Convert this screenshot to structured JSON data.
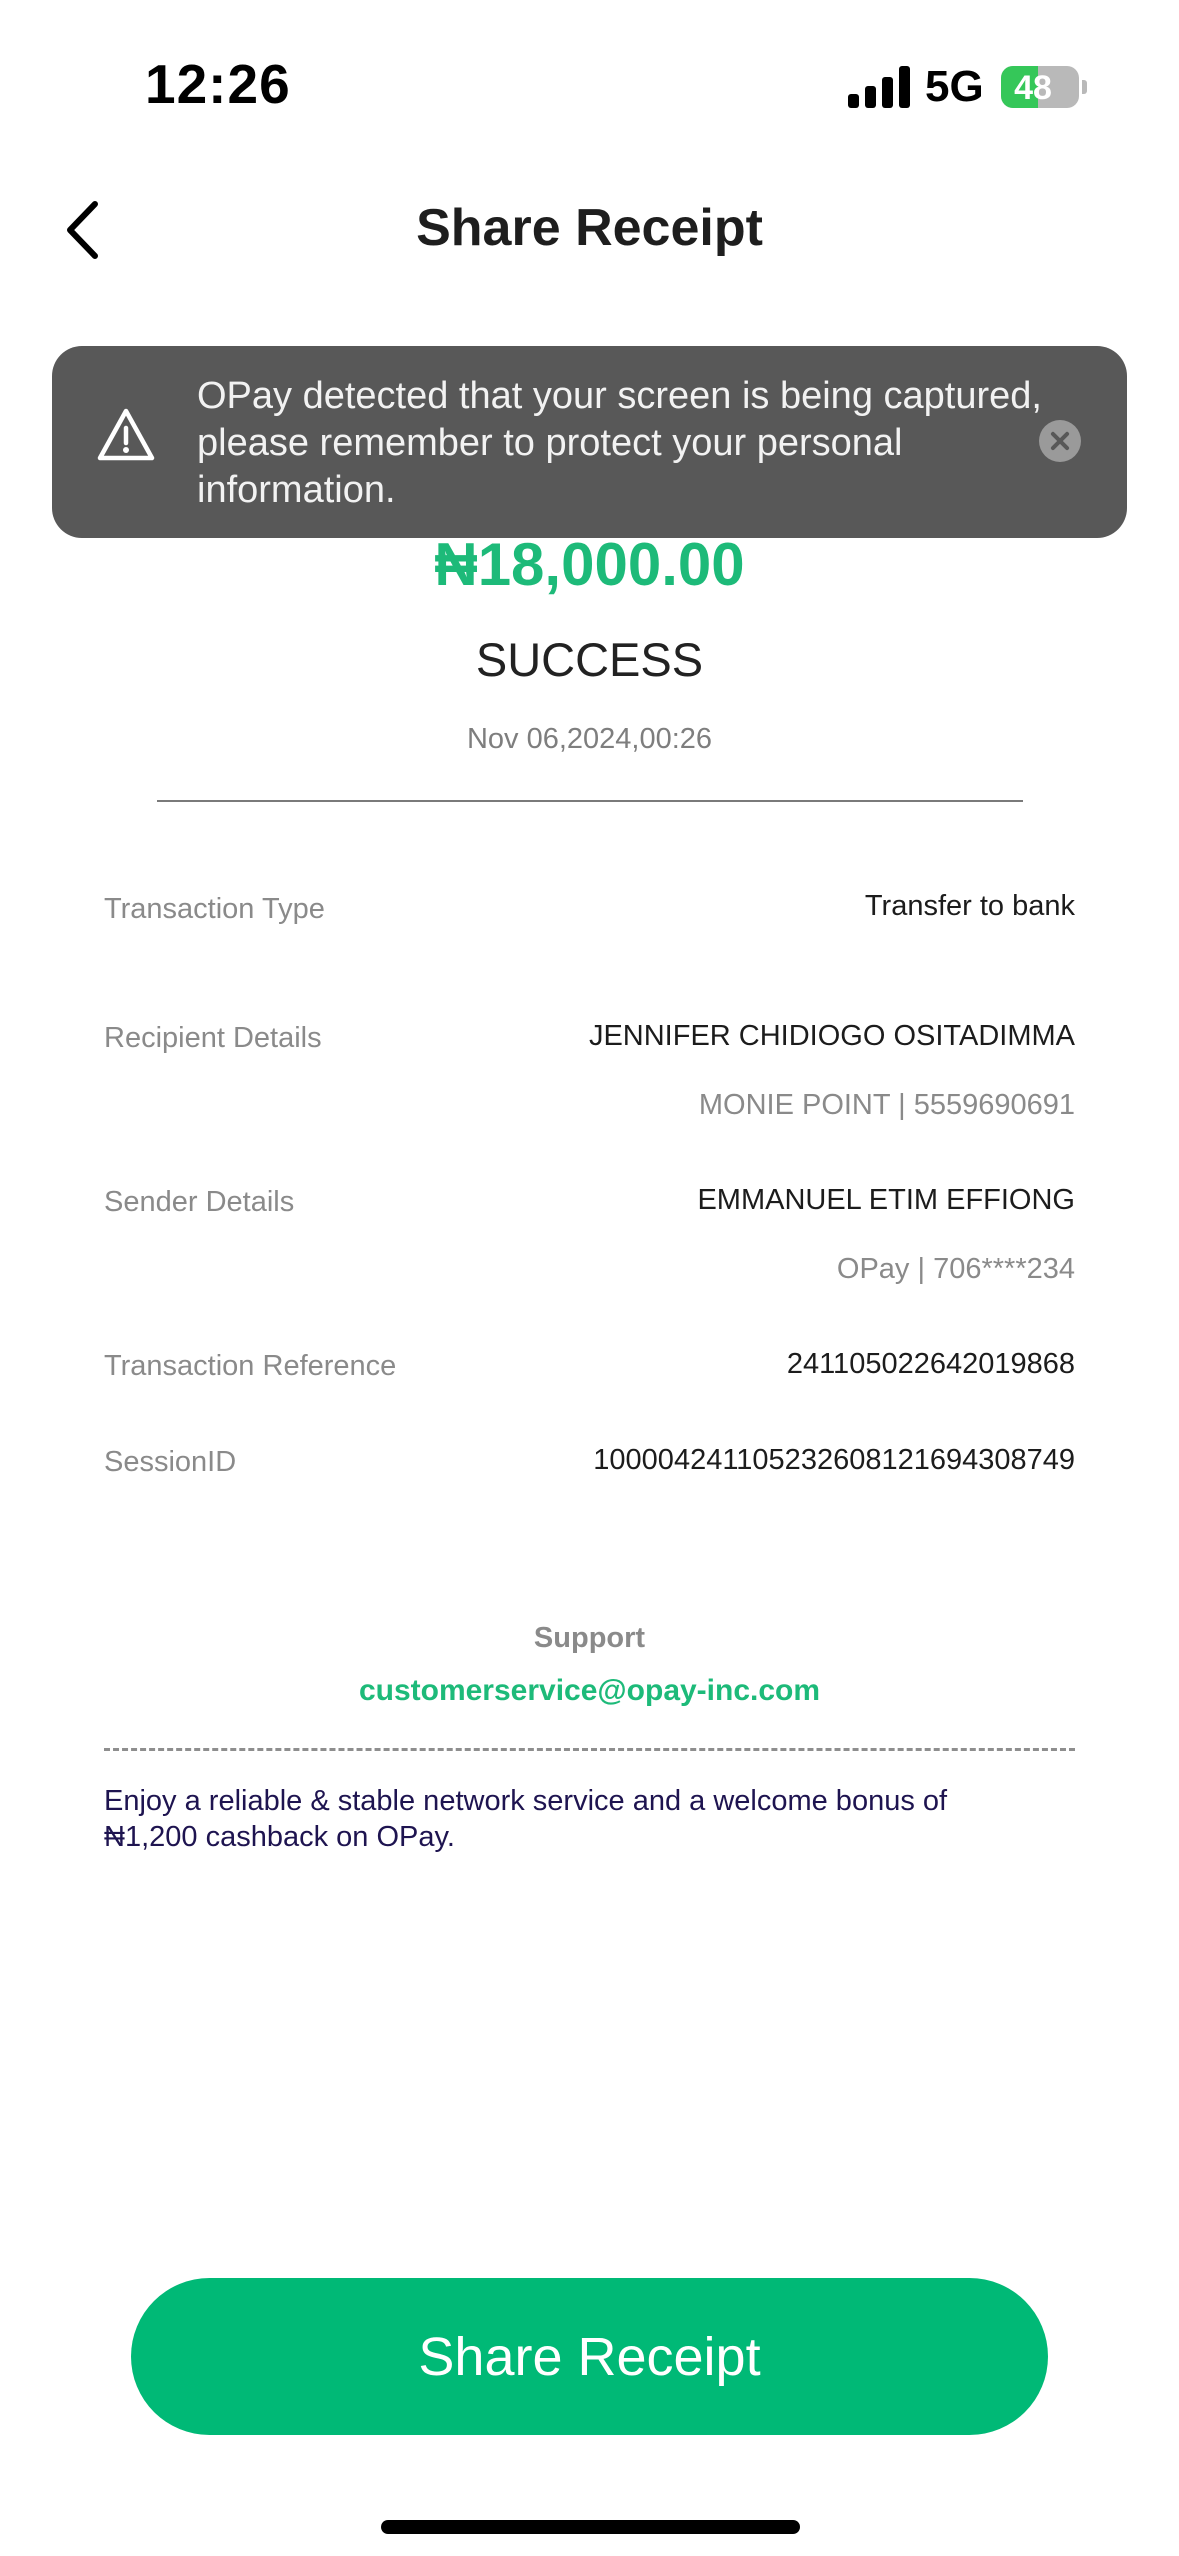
{
  "status_bar": {
    "time": "12:26",
    "network": "5G",
    "battery": "48",
    "battery_level": 0.48
  },
  "nav": {
    "title": "Share Receipt",
    "back_icon": "chevron-left-icon"
  },
  "receipt": {
    "amount": "₦18,000.00",
    "status": "SUCCESS",
    "datetime": "Nov 06,2024,00:26"
  },
  "details": {
    "transaction_type": {
      "label": "Transaction Type",
      "value": "Transfer to bank"
    },
    "recipient": {
      "label": "Recipient Details",
      "name": "JENNIFER CHIDIOGO OSITADIMMA",
      "bank": "MONIE POINT | 5559690691"
    },
    "sender": {
      "label": "Sender Details",
      "name": "EMMANUEL ETIM EFFIONG",
      "bank": "OPay | 706****234"
    },
    "reference": {
      "label": "Transaction Reference",
      "value": "241105022642019868"
    },
    "session": {
      "label": "SessionID",
      "value": "100004241105232608121694308749"
    }
  },
  "support": {
    "label": "Support",
    "email": "customerservice@opay-inc.com"
  },
  "promo": {
    "text": "Enjoy a reliable & stable network service and a welcome bonus of ₦1,200 cashback on OPay."
  },
  "share_button": {
    "label": "Share Receipt"
  },
  "toast": {
    "message": "OPay detected that your screen is being captured, please remember to protect your personal information.",
    "icon": "warning-icon",
    "close_icon": "close-icon"
  },
  "colors": {
    "accent": "#1dba79",
    "button": "#00b976",
    "toast_bg": "#585858"
  }
}
